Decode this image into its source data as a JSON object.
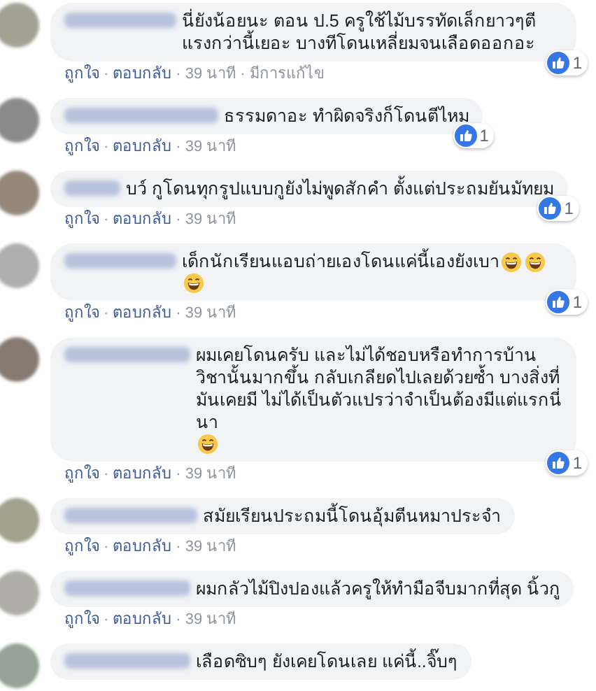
{
  "comments": [
    {
      "segments": [
        {
          "kind": "text",
          "text": "นี่ยังน้อยนะ ตอน ป.5 ครูใช้ไม้บรรทัดเล็กยาวๆตี แรงกว่านี้เยอะ บางทีโดนเหลี่ยมจนเลือดออกอะ"
        }
      ],
      "reactions": "1",
      "meta": [
        {
          "kind": "link",
          "text": "ถูกใจ"
        },
        {
          "kind": "dot",
          "text": "·"
        },
        {
          "kind": "link",
          "text": "ตอบกลับ"
        },
        {
          "kind": "dot",
          "text": "·"
        },
        {
          "kind": "time",
          "text": "39 นาที"
        },
        {
          "kind": "dot",
          "text": "·"
        },
        {
          "kind": "time",
          "text": "มีการแก้ไข"
        }
      ]
    },
    {
      "segments": [
        {
          "kind": "text",
          "text": "ธรรมดาอะ ทำผิดจริงก็โดนตีไหม"
        }
      ],
      "reactions": "1",
      "meta": [
        {
          "kind": "link",
          "text": "ถูกใจ"
        },
        {
          "kind": "dot",
          "text": "·"
        },
        {
          "kind": "link",
          "text": "ตอบกลับ"
        },
        {
          "kind": "dot",
          "text": "·"
        },
        {
          "kind": "time",
          "text": "39 นาที"
        }
      ]
    },
    {
      "segments": [
        {
          "kind": "text",
          "text": "บว์ กูโดนทุกรูปแบบกูยังไม่พูดสักคำ ตั้งแต่ประถมยันมัทยม"
        }
      ],
      "reactions": "1",
      "meta": [
        {
          "kind": "link",
          "text": "ถูกใจ"
        },
        {
          "kind": "dot",
          "text": "·"
        },
        {
          "kind": "link",
          "text": "ตอบกลับ"
        },
        {
          "kind": "dot",
          "text": "·"
        },
        {
          "kind": "time",
          "text": "39 นาที"
        }
      ]
    },
    {
      "segments": [
        {
          "kind": "text",
          "text": "เด็กนักเรียนแอบถ่ายเองโดนแค่นี้เองยังเบา"
        },
        {
          "kind": "emoji"
        },
        {
          "kind": "emoji"
        },
        {
          "kind": "emoji"
        }
      ],
      "reactions": "1",
      "meta": [
        {
          "kind": "link",
          "text": "ถูกใจ"
        },
        {
          "kind": "dot",
          "text": "·"
        },
        {
          "kind": "link",
          "text": "ตอบกลับ"
        },
        {
          "kind": "dot",
          "text": "·"
        },
        {
          "kind": "time",
          "text": "39 นาที"
        }
      ]
    },
    {
      "segments": [
        {
          "kind": "text",
          "text": "ผมเคยโดนครับ และไม่ได้ชอบหรือทำการบ้านวิชานั้นมากขึ้น กลับเกลียดไปเลยด้วยซ้ำ บางสิ่งที่มันเคยมี ไม่ได้เป็นตัวแปรว่าจำเป็นต้องมีแต่แรกนี่นา"
        },
        {
          "kind": "emoji"
        }
      ],
      "reactions": "1",
      "meta": [
        {
          "kind": "link",
          "text": "ถูกใจ"
        },
        {
          "kind": "dot",
          "text": "·"
        },
        {
          "kind": "link",
          "text": "ตอบกลับ"
        },
        {
          "kind": "dot",
          "text": "·"
        },
        {
          "kind": "time",
          "text": "39 นาที"
        }
      ]
    },
    {
      "segments": [
        {
          "kind": "text",
          "text": "สมัยเรียนประถมนี้โดนอุ้มตีนหมาประจำ"
        }
      ],
      "meta": [
        {
          "kind": "link",
          "text": "ถูกใจ"
        },
        {
          "kind": "dot",
          "text": "·"
        },
        {
          "kind": "link",
          "text": "ตอบกลับ"
        },
        {
          "kind": "dot",
          "text": "·"
        },
        {
          "kind": "time",
          "text": "39 นาที"
        }
      ]
    },
    {
      "segments": [
        {
          "kind": "text",
          "text": "ผมกลัวไม้ปิงปองแล้วครูให้ทำมือจีบมากที่สุด นิ้วกู"
        }
      ],
      "meta": [
        {
          "kind": "link",
          "text": "ถูกใจ"
        },
        {
          "kind": "dot",
          "text": "·"
        },
        {
          "kind": "link",
          "text": "ตอบกลับ"
        },
        {
          "kind": "dot",
          "text": "·"
        },
        {
          "kind": "time",
          "text": "39 นาที"
        }
      ]
    },
    {
      "segments": [
        {
          "kind": "text",
          "text": "เลือดซิบๆ ยังเคยโดนเลย แค่นี้..จิ๊บๆ"
        }
      ]
    }
  ]
}
